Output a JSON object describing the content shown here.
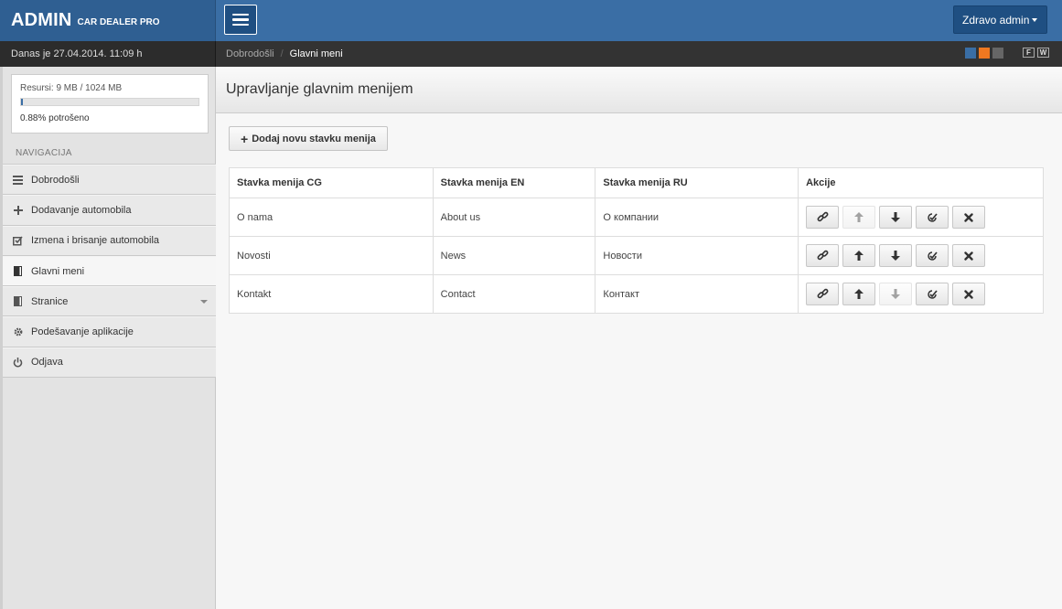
{
  "brand": {
    "title": "ADMIN",
    "subtitle": "CAR DEALER PRO"
  },
  "header": {
    "user_menu_label": "Zdravo admin"
  },
  "datebar": {
    "text": "Danas je 27.04.2014. 11:09 h"
  },
  "breadcrumb": {
    "home": "Dobrodošli",
    "separator": "/",
    "current": "Glavni meni"
  },
  "theme_swatches": [
    "#3a6ea5",
    "#f07820",
    "#666666"
  ],
  "view_toggles": [
    "F",
    "W"
  ],
  "resources": {
    "label": "Resursi: 9 MB / 1024 MB",
    "used_fraction": 0.0088,
    "used_label": "0.88% potrošeno"
  },
  "sidebar": {
    "header": "NAVIGACIJA",
    "items": [
      {
        "label": "Dobrodošli",
        "icon": "list-icon",
        "active": false
      },
      {
        "label": "Dodavanje automobila",
        "icon": "plus-icon",
        "active": false
      },
      {
        "label": "Izmena i brisanje automobila",
        "icon": "edit-icon",
        "active": false
      },
      {
        "label": "Glavni meni",
        "icon": "book-icon",
        "active": true
      },
      {
        "label": "Stranice",
        "icon": "book-icon",
        "active": false,
        "has_dropdown": true
      },
      {
        "label": "Podešavanje aplikacije",
        "icon": "gear-icon",
        "active": false
      },
      {
        "label": "Odjava",
        "icon": "power-icon",
        "active": false
      }
    ]
  },
  "main": {
    "title": "Upravljanje glavnim menijem",
    "add_button": "Dodaj novu stavku menija",
    "columns": [
      "Stavka menija CG",
      "Stavka menija EN",
      "Stavka menija RU",
      "Akcije"
    ],
    "rows": [
      {
        "cg": "O nama",
        "en": "About us",
        "ru": "О компании",
        "up_disabled": true,
        "down_disabled": false
      },
      {
        "cg": "Novosti",
        "en": "News",
        "ru": "Новости",
        "up_disabled": false,
        "down_disabled": false
      },
      {
        "cg": "Kontakt",
        "en": "Contact",
        "ru": "Контакт",
        "up_disabled": false,
        "down_disabled": true
      }
    ]
  }
}
